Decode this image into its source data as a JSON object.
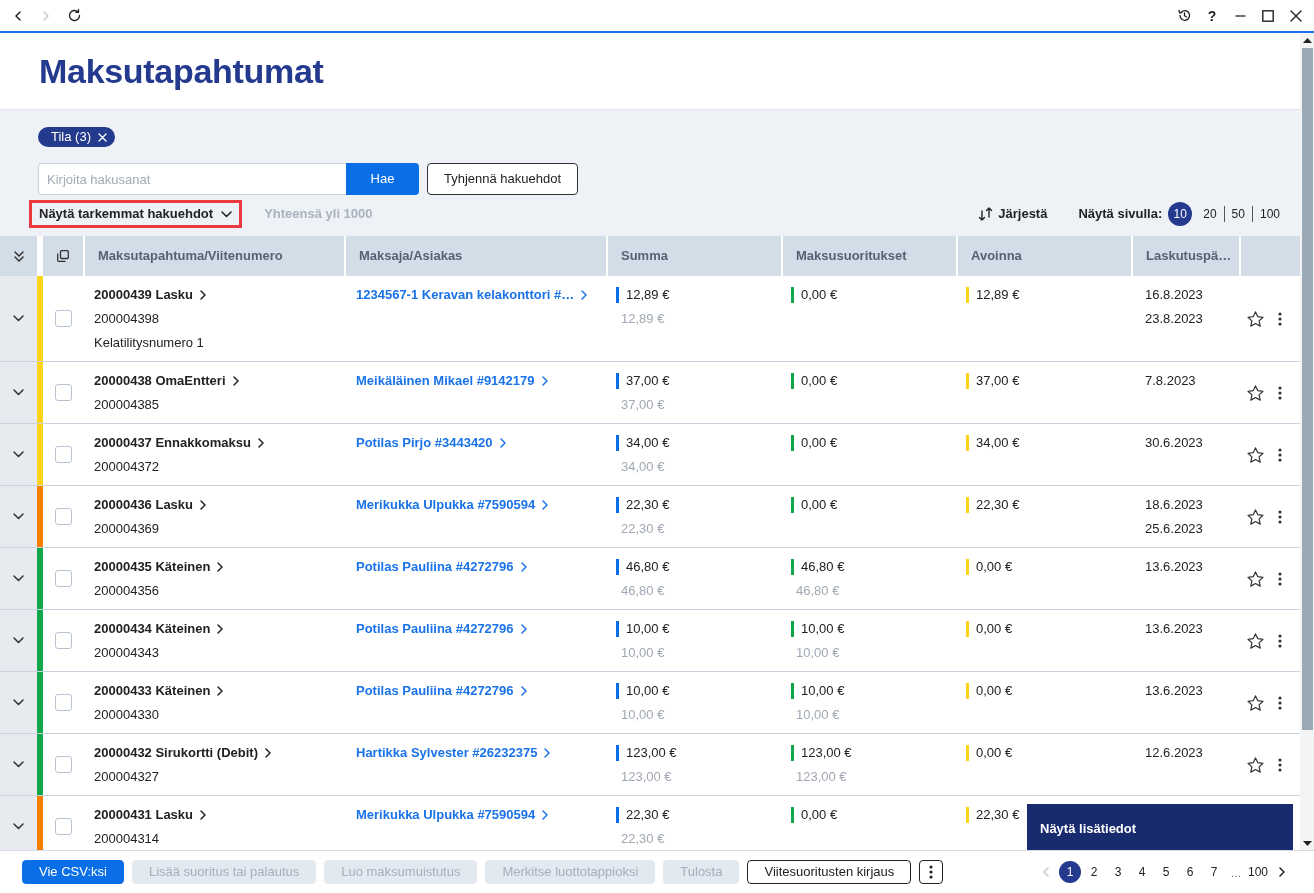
{
  "browser": {
    "back_disabled": false,
    "forward_disabled": true,
    "help": "?"
  },
  "page": {
    "title": "Maksutapahtumat"
  },
  "filters": {
    "chips": [
      {
        "label": "Tila (3)"
      }
    ],
    "search": {
      "placeholder": "Kirjoita hakusanat",
      "button": "Hae"
    },
    "clear_button": "Tyhjennä hakuehdot",
    "more_toggle": {
      "label": "Näytä tarkemmat hakuehdot",
      "highlighted": true
    },
    "total": "Yhteensä yli 1000",
    "sort_button": "Järjestä",
    "page_size": {
      "label": "Näytä sivulla:",
      "options": [
        {
          "label": "10",
          "selected": true
        },
        {
          "label": "20",
          "selected": false
        },
        {
          "label": "50",
          "selected": false
        },
        {
          "label": "100",
          "selected": false
        }
      ]
    }
  },
  "table": {
    "columns": [
      "Maksutapahtuma/Viitenumero",
      "Maksaja/Asiakas",
      "Summa",
      "Maksusuoritukset",
      "Avoinna",
      "Laskutuspä…"
    ],
    "rows": [
      {
        "color": "#fcd419",
        "checked": false,
        "title": "20000439 Lasku",
        "reference": "200004398",
        "note": "Kelatilitysnumero 1",
        "payer": "1234567-1 Keravan kelakonttori #…",
        "sum": "12,89 €",
        "sum_sub": "12,89 €",
        "paid": "0,00 €",
        "open": "12,89 €",
        "dates": [
          "16.8.2023",
          "23.8.2023"
        ],
        "starred": false
      },
      {
        "color": "#fcd419",
        "checked": false,
        "title": "20000438 OmaEntteri",
        "reference": "200004385",
        "payer": "Meikäläinen Mikael #9142179",
        "sum": "37,00 €",
        "sum_sub": "37,00 €",
        "paid": "0,00 €",
        "open": "37,00 €",
        "dates": [
          "7.8.2023"
        ],
        "starred": false
      },
      {
        "color": "#fcd419",
        "checked": false,
        "title": "20000437 Ennakkomaksu",
        "reference": "200004372",
        "payer": "Potilas Pirjo #3443420",
        "sum": "34,00 €",
        "sum_sub": "34,00 €",
        "paid": "0,00 €",
        "open": "34,00 €",
        "dates": [
          "30.6.2023"
        ],
        "starred": false
      },
      {
        "color": "#f77f00",
        "checked": false,
        "title": "20000436 Lasku",
        "reference": "200004369",
        "payer": "Merikukka Ulpukka #7590594",
        "sum": "22,30 €",
        "sum_sub": "22,30 €",
        "paid": "0,00 €",
        "open": "22,30 €",
        "dates": [
          "18.6.2023",
          "25.6.2023"
        ],
        "starred": false
      },
      {
        "color": "#12a64a",
        "checked": false,
        "title": "20000435 Käteinen",
        "reference": "200004356",
        "payer": "Potilas Pauliina #4272796",
        "sum": "46,80 €",
        "sum_sub": "46,80 €",
        "paid": "46,80 €",
        "paid_sub": "46,80 €",
        "open": "0,00 €",
        "dates": [
          "13.6.2023"
        ],
        "starred": false
      },
      {
        "color": "#12a64a",
        "checked": false,
        "title": "20000434 Käteinen",
        "reference": "200004343",
        "payer": "Potilas Pauliina #4272796",
        "sum": "10,00 €",
        "sum_sub": "10,00 €",
        "paid": "10,00 €",
        "paid_sub": "10,00 €",
        "open": "0,00 €",
        "dates": [
          "13.6.2023"
        ],
        "starred": false
      },
      {
        "color": "#12a64a",
        "checked": false,
        "title": "20000433 Käteinen",
        "reference": "200004330",
        "payer": "Potilas Pauliina #4272796",
        "sum": "10,00 €",
        "sum_sub": "10,00 €",
        "paid": "10,00 €",
        "paid_sub": "10,00 €",
        "open": "0,00 €",
        "dates": [
          "13.6.2023"
        ],
        "starred": false
      },
      {
        "color": "#12a64a",
        "checked": false,
        "title": "20000432 Sirukortti (Debit)",
        "reference": "200004327",
        "payer": "Hartikka Sylvester #26232375",
        "sum": "123,00 €",
        "sum_sub": "123,00 €",
        "paid": "123,00 €",
        "paid_sub": "123,00 €",
        "open": "0,00 €",
        "dates": [
          "12.6.2023"
        ],
        "starred": false
      },
      {
        "color": "#f77f00",
        "checked": false,
        "title": "20000431 Lasku",
        "reference": "200004314",
        "payer": "Merikukka Ulpukka #7590594",
        "sum": "22,30 €",
        "sum_sub": "22,30 €",
        "paid": "0,00 €",
        "open": "22,30 €",
        "tooltip": "Näytä lisätiedot"
      }
    ]
  },
  "toolbar": {
    "buttons": [
      {
        "label": "Vie CSV:ksi",
        "kind": "primary",
        "disabled": false
      },
      {
        "label": "Lisää suoritus tai palautus",
        "kind": "secondary",
        "disabled": true
      },
      {
        "label": "Luo maksumuistutus",
        "kind": "secondary",
        "disabled": true
      },
      {
        "label": "Merkitse luottotappioksi",
        "kind": "secondary",
        "disabled": true
      },
      {
        "label": "Tulosta",
        "kind": "secondary",
        "disabled": true
      },
      {
        "label": "Viitesuoritusten kirjaus",
        "kind": "outline",
        "disabled": false
      }
    ]
  },
  "pagination": {
    "prev_disabled": true,
    "next_disabled": false,
    "pages": [
      {
        "kind": "page",
        "label": "1",
        "selected": true
      },
      {
        "kind": "page",
        "label": "2",
        "selected": false
      },
      {
        "kind": "page",
        "label": "3",
        "selected": false
      },
      {
        "kind": "page",
        "label": "4",
        "selected": false
      },
      {
        "kind": "page",
        "label": "5",
        "selected": false
      },
      {
        "kind": "page",
        "label": "6",
        "selected": false
      },
      {
        "kind": "page",
        "label": "7",
        "selected": false
      },
      {
        "kind": "gap",
        "label": "…",
        "selected": false
      },
      {
        "kind": "page",
        "label": "100",
        "selected": false
      }
    ]
  }
}
